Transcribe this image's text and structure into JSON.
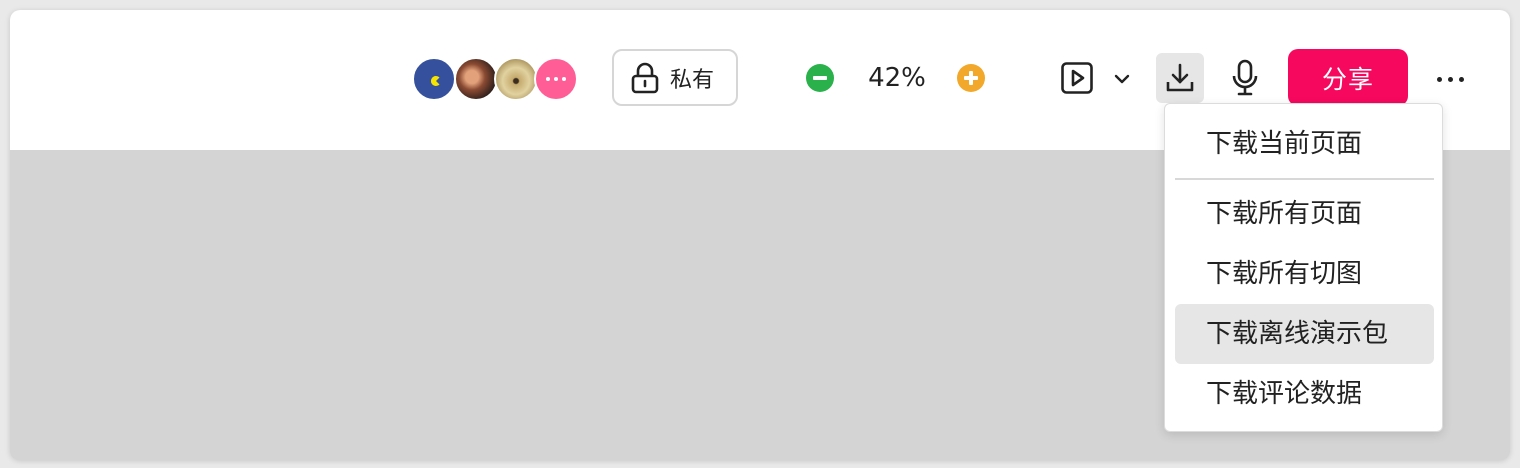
{
  "toolbar": {
    "collaborators": [
      {
        "name": "avatar-1"
      },
      {
        "name": "avatar-2"
      },
      {
        "name": "avatar-3"
      }
    ],
    "privacy_label": "私有",
    "zoom_value": "42%",
    "share_label": "分享",
    "icons": {
      "lock": "lock-icon",
      "zoom_out": "minus-circle-icon",
      "zoom_in": "plus-circle-icon",
      "present": "play-square-icon",
      "caret": "chevron-down-icon",
      "download": "download-icon",
      "microphone": "microphone-icon",
      "more": "more-horizontal-icon"
    },
    "colors": {
      "share": "#f5085e",
      "zoom_out": "#2bb14b",
      "zoom_in": "#f2a82a",
      "more_avatars": "#ff5d95"
    }
  },
  "download_menu": {
    "items": [
      {
        "label": "下载当前页面",
        "highlighted": false
      },
      {
        "label": "下载所有页面",
        "highlighted": false
      },
      {
        "label": "下载所有切图",
        "highlighted": false
      },
      {
        "label": "下载离线演示包",
        "highlighted": true
      },
      {
        "label": "下载评论数据",
        "highlighted": false
      }
    ]
  }
}
